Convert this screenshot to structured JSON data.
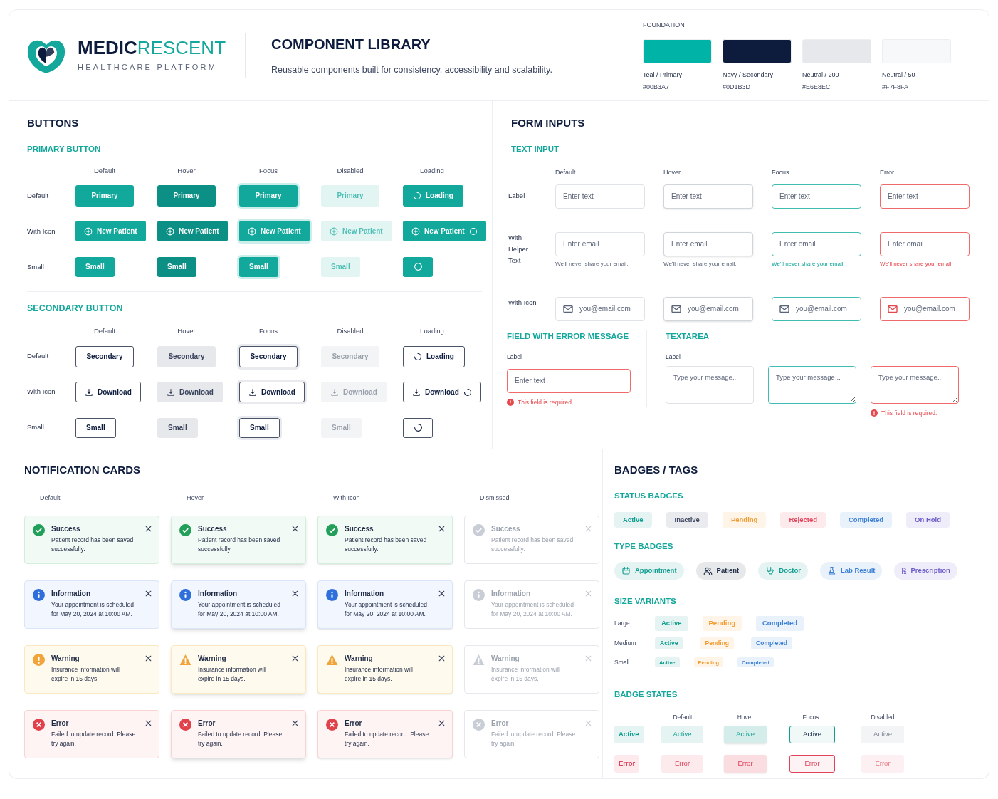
{
  "header": {
    "logo": {
      "brand_dark": "MEDIC",
      "brand_teal": "RESCENT",
      "tagline": "HEALTHCARE PLATFORM"
    },
    "title": "COMPONENT LIBRARY",
    "subtitle": "Reusable components built for consistency, accessibility and scalability.",
    "foundation": {
      "label": "FOUNDATION",
      "swatches": [
        {
          "name": "Teal / Primary",
          "hex": "#00B3A7",
          "color": "#00b3a7"
        },
        {
          "name": "Navy / Secondary",
          "hex": "#0D1B3D",
          "color": "#0d1b3d"
        },
        {
          "name": "Neutral / 200",
          "hex": "#E6E8EC",
          "color": "#e6e8ec"
        },
        {
          "name": "Neutral / 50",
          "hex": "#F7F8FA",
          "color": "#f7f8fa"
        }
      ]
    }
  },
  "buttons": {
    "title": "BUTTONS",
    "groups": [
      {
        "title": "PRIMARY BUTTON",
        "kind": "primary",
        "columns": [
          "Default",
          "Hover",
          "Focus",
          "Disabled",
          "Loading"
        ],
        "rows": [
          {
            "label": "Default",
            "kind": "default",
            "cells": [
              {
                "text": "Primary",
                "kind": "default"
              },
              {
                "text": "Primary",
                "kind": "hover"
              },
              {
                "text": "Primary",
                "kind": "focus"
              },
              {
                "text": "Primary",
                "kind": "disabled"
              },
              {
                "text": "Loading",
                "kind": "loading"
              }
            ]
          },
          {
            "label": "With Icon",
            "kind": "icon",
            "cells": [
              {
                "text": "New Patient",
                "kind": "default"
              },
              {
                "text": "New Patient",
                "kind": "hover"
              },
              {
                "text": "New Patient",
                "kind": "focus"
              },
              {
                "text": "New Patient",
                "kind": "disabled"
              },
              {
                "text": "New Patient",
                "kind": "loading"
              }
            ]
          },
          {
            "label": "Small",
            "kind": "small",
            "cells": [
              {
                "text": "Small",
                "kind": "default"
              },
              {
                "text": "Small",
                "kind": "hover"
              },
              {
                "text": "Small",
                "kind": "focus"
              },
              {
                "text": "Small",
                "kind": "disabled"
              },
              {
                "kind": "loading"
              }
            ]
          }
        ]
      },
      {
        "title": "SECONDARY BUTTON",
        "kind": "secondary",
        "columns": [
          "Default",
          "Hover",
          "Focus",
          "Disabled",
          "Loading"
        ],
        "rows": [
          {
            "label": "Default",
            "kind": "default",
            "cells": [
              {
                "text": "Secondary",
                "kind": "default"
              },
              {
                "text": "Secondary",
                "kind": "hover"
              },
              {
                "text": "Secondary",
                "kind": "focus"
              },
              {
                "text": "Secondary",
                "kind": "disabled"
              },
              {
                "text": "Loading",
                "kind": "loading"
              }
            ]
          },
          {
            "label": "With Icon",
            "kind": "icon",
            "cells": [
              {
                "text": "Download",
                "kind": "default"
              },
              {
                "text": "Download",
                "kind": "hover"
              },
              {
                "text": "Download",
                "kind": "focus"
              },
              {
                "text": "Download",
                "kind": "disabled"
              },
              {
                "text": "Download",
                "kind": "loading"
              }
            ]
          },
          {
            "label": "Small",
            "kind": "small",
            "cells": [
              {
                "text": "Small",
                "kind": "default"
              },
              {
                "text": "Small",
                "kind": "hover"
              },
              {
                "text": "Small",
                "kind": "focus"
              },
              {
                "text": "Small",
                "kind": "disabled"
              },
              {
                "kind": "loading"
              }
            ]
          }
        ]
      }
    ]
  },
  "form_inputs": {
    "title": "FORM INPUTS",
    "text_input": {
      "title": "TEXT INPUT",
      "columns": [
        "Default",
        "Hover",
        "Focus",
        "Error"
      ],
      "rows": [
        {
          "label": "Label",
          "kind": "plain",
          "fields": [
            {
              "placeholder": "Enter text",
              "kind": "default"
            },
            {
              "placeholder": "Enter text",
              "kind": "hover"
            },
            {
              "placeholder": "Enter text",
              "kind": "focus"
            },
            {
              "placeholder": "Enter text",
              "kind": "error"
            }
          ]
        },
        {
          "label": "With Helper Text",
          "kind": "helper",
          "fields": [
            {
              "placeholder": "Enter email",
              "kind": "default",
              "helper": "We'll never share your email."
            },
            {
              "placeholder": "Enter email",
              "kind": "hover",
              "helper": "We'll never share your email."
            },
            {
              "placeholder": "Enter email",
              "kind": "focus",
              "helper": "We'll never share your email."
            },
            {
              "placeholder": "Enter email",
              "kind": "error",
              "helper": "We'll never share your email."
            }
          ]
        },
        {
          "label": "With Icon",
          "kind": "icon",
          "fields": [
            {
              "placeholder": "you@email.com",
              "kind": "default"
            },
            {
              "placeholder": "you@email.com",
              "kind": "hover"
            },
            {
              "placeholder": "you@email.com",
              "kind": "focus"
            },
            {
              "placeholder": "you@email.com",
              "kind": "error"
            }
          ]
        }
      ]
    },
    "field_error": {
      "title": "FIELD WITH ERROR MESSAGE",
      "label": "Label",
      "placeholder": "Enter text",
      "error": "This field is required."
    },
    "textarea": {
      "title": "TEXTAREA",
      "label": "Label",
      "fields": [
        {
          "placeholder": "Type your message...",
          "kind": "default"
        },
        {
          "placeholder": "Type your message...",
          "kind": "focus"
        },
        {
          "placeholder": "Type your message...",
          "kind": "error",
          "error": "This field is required."
        }
      ]
    }
  },
  "notifications": {
    "title": "NOTIFICATION CARDS",
    "columns": [
      "Default",
      "Hover",
      "With Icon",
      "Dismissed"
    ],
    "rows": [
      {
        "kind": "success",
        "cards": [
          {
            "kind": "default",
            "title": "Success",
            "message": "Patient record has been saved successfully."
          },
          {
            "kind": "hover",
            "title": "Success",
            "message": "Patient record has been saved successfully."
          },
          {
            "kind": "with_icon",
            "title": "Success",
            "message": "Patient record has been saved successfully."
          },
          {
            "kind": "dismissed",
            "title": "Success",
            "message": "Patient record has been saved successfully."
          }
        ]
      },
      {
        "kind": "info",
        "cards": [
          {
            "kind": "default",
            "title": "Information",
            "message": "Your appointment is scheduled for May 20, 2024 at 10:00 AM."
          },
          {
            "kind": "hover",
            "title": "Information",
            "message": "Your appointment is scheduled for May 20, 2024 at 10:00 AM."
          },
          {
            "kind": "with_icon",
            "title": "Information",
            "message": "Your appointment is scheduled for May 20, 2024 at 10:00 AM."
          },
          {
            "kind": "dismissed",
            "title": "Information",
            "message": "Your appointment is scheduled for May 20, 2024 at 10:00 AM."
          }
        ]
      },
      {
        "kind": "warning",
        "cards": [
          {
            "kind": "default",
            "title": "Warning",
            "message": "Insurance information will expire in 15 days."
          },
          {
            "kind": "hover",
            "title": "Warning",
            "message": "Insurance information will expire in 15 days."
          },
          {
            "kind": "with_icon",
            "title": "Warning",
            "message": "Insurance information will expire in 15 days."
          },
          {
            "kind": "dismissed",
            "title": "Warning",
            "message": "Insurance information will expire in 15 days."
          }
        ]
      },
      {
        "kind": "error",
        "cards": [
          {
            "kind": "default",
            "title": "Error",
            "message": "Failed to update record. Please try again."
          },
          {
            "kind": "hover",
            "title": "Error",
            "message": "Failed to update record. Please try again."
          },
          {
            "kind": "with_icon",
            "title": "Error",
            "message": "Failed to update record. Please try again."
          },
          {
            "kind": "dismissed",
            "title": "Error",
            "message": "Failed to update record. Please try again."
          }
        ]
      }
    ]
  },
  "badges": {
    "title": "BADGES / TAGS",
    "status": {
      "title": "STATUS BADGES",
      "items": [
        {
          "label": "Active",
          "color": "#109d8f"
        },
        {
          "label": "Inactive",
          "color": "#3d4660"
        },
        {
          "label": "Pending",
          "color": "#f29a2e"
        },
        {
          "label": "Rejected",
          "color": "#e0435a"
        },
        {
          "label": "Completed",
          "color": "#3a7fd5"
        },
        {
          "label": "On Hold",
          "color": "#6a5cc8"
        }
      ]
    },
    "types": {
      "title": "TYPE BADGES",
      "items": [
        {
          "kind": "appointment",
          "label": "Appointment",
          "color": "#109d8f"
        },
        {
          "kind": "patient",
          "label": "Patient",
          "color": "#1f2a44"
        },
        {
          "kind": "doctor",
          "label": "Doctor",
          "color": "#109d8f"
        },
        {
          "kind": "lab",
          "label": "Lab Result",
          "color": "#3a7fd5"
        },
        {
          "kind": "prescription",
          "symbol": "℞",
          "label": "Prescription",
          "color": "#6a5cc8"
        }
      ]
    },
    "sizes": {
      "title": "SIZE VARIANTS",
      "rows": [
        {
          "label": "Large",
          "kind": "large",
          "items": [
            {
              "label": "Active",
              "color": "#109d8f"
            },
            {
              "label": "Pending",
              "color": "#f29a2e"
            },
            {
              "label": "Completed",
              "color": "#3a7fd5"
            }
          ]
        },
        {
          "label": "Medium",
          "kind": "medium",
          "items": [
            {
              "label": "Active",
              "color": "#109d8f"
            },
            {
              "label": "Pending",
              "color": "#f29a2e"
            },
            {
              "label": "Completed",
              "color": "#3a7fd5"
            }
          ]
        },
        {
          "label": "Small",
          "kind": "small",
          "items": [
            {
              "label": "Active",
              "color": "#109d8f"
            },
            {
              "label": "Pending",
              "color": "#f29a2e"
            },
            {
              "label": "Completed",
              "color": "#3a7fd5"
            }
          ]
        }
      ]
    },
    "states": {
      "title": "BADGE STATES",
      "columns": [
        "",
        "Default",
        "Hover",
        "Focus",
        "Disabled"
      ],
      "rows": [
        {
          "color": "#109d8f",
          "cells": [
            {
              "text": "Active",
              "kind": "base"
            },
            {
              "text": "Active",
              "kind": "default"
            },
            {
              "text": "Active",
              "kind": "hover"
            },
            {
              "text": "Active",
              "kind": "focus"
            },
            {
              "text": "Active",
              "kind": "disabled"
            }
          ]
        },
        {
          "color": "#e0435a",
          "cells": [
            {
              "text": "Error",
              "kind": "base"
            },
            {
              "text": "Error",
              "kind": "default"
            },
            {
              "text": "Error",
              "kind": "hover"
            },
            {
              "text": "Error",
              "kind": "focus"
            },
            {
              "text": "Error",
              "kind": "disabled"
            }
          ]
        }
      ]
    }
  }
}
